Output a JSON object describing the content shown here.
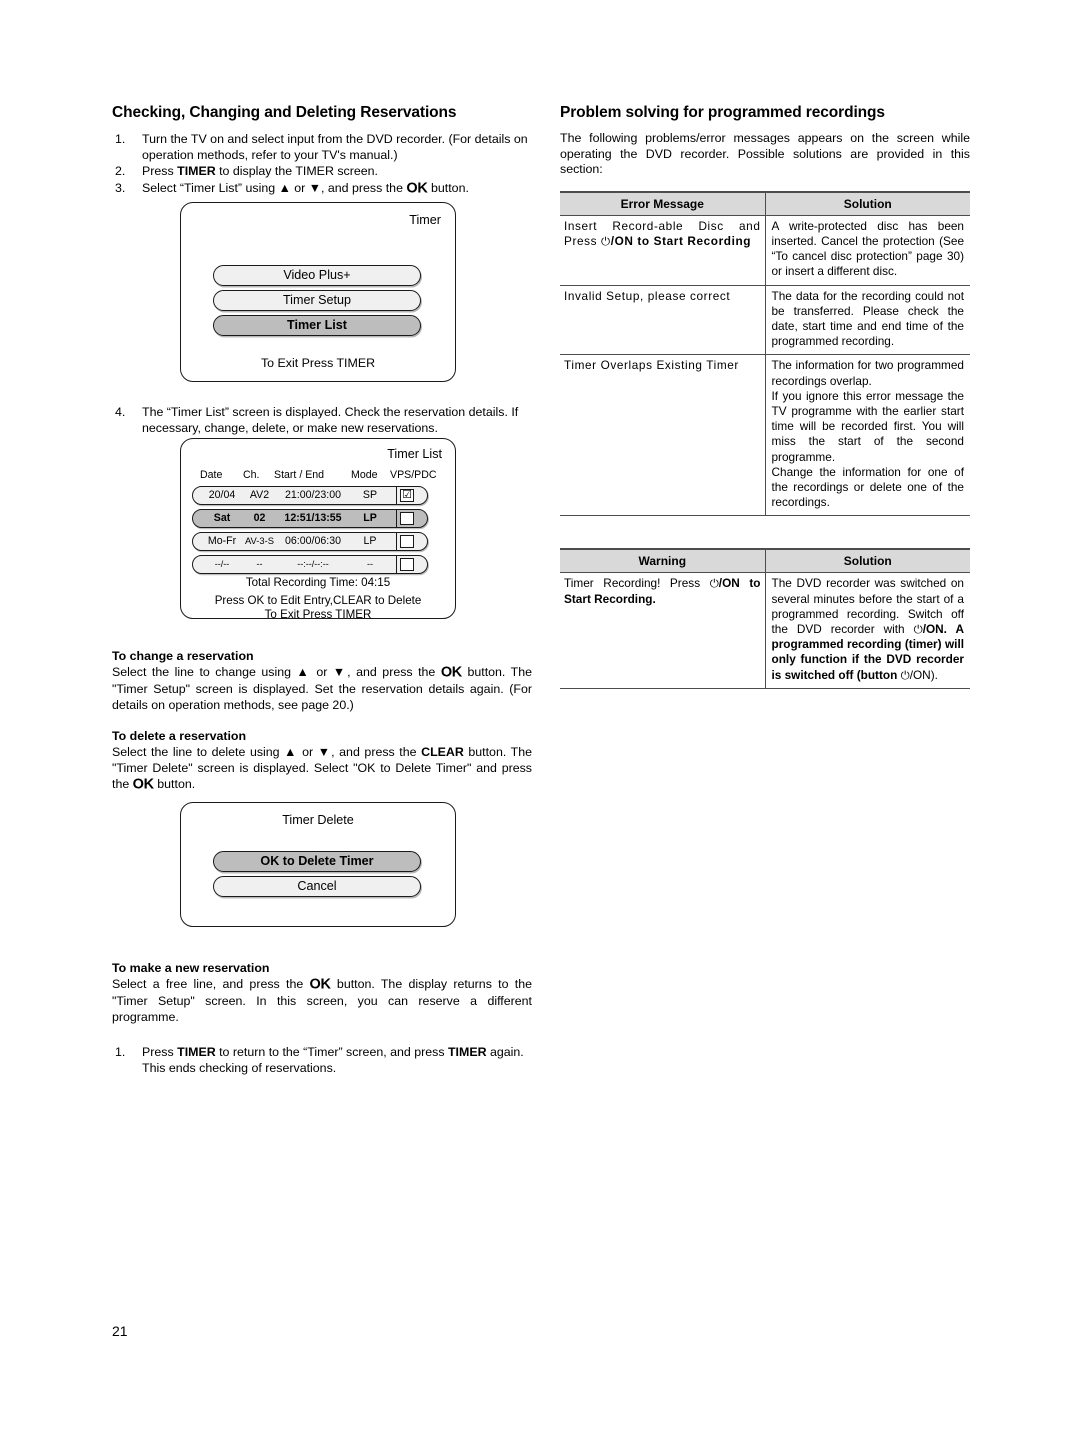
{
  "page": {
    "number": "21"
  },
  "left": {
    "heading": "Checking, Changing and Deleting Reservations",
    "steps": [
      {
        "num": "1.",
        "text_a": "Turn the TV on and select input from the DVD recorder. (For details on operation methods, refer to your TV's manual.)"
      },
      {
        "num": "2.",
        "pre": "Press ",
        "kw": "TIMER",
        "post": " to display the TIMER screen."
      },
      {
        "num": "3.",
        "pre": "Select “Timer List” using ▲ or ▼, and press the ",
        "kw": "OK",
        "post": " button."
      }
    ],
    "step4": {
      "num": "4.",
      "text": "The “Timer List” screen is displayed. Check the reservation details. If necessary, change, delete, or make new reservations."
    },
    "timer_screen": {
      "title": "Timer",
      "items": [
        {
          "label": "Video Plus+",
          "selected": false
        },
        {
          "label": "Timer Setup",
          "selected": false
        },
        {
          "label": "Timer List",
          "selected": true
        }
      ],
      "footer": "To Exit Press TIMER"
    },
    "timer_list_screen": {
      "title": "Timer List",
      "columns": [
        "Date",
        "Ch.",
        "Start / End",
        "Mode",
        "VPS/PDC"
      ],
      "rows": [
        {
          "date": "20/04",
          "ch": "AV2",
          "start_end": "21:00/23:00",
          "mode": "SP",
          "vps": "☑",
          "selected": false
        },
        {
          "date": "Sat",
          "ch": "02",
          "start_end": "12:51/13:55",
          "mode": "LP",
          "vps": "",
          "selected": true
        },
        {
          "date": "Mo-Fr",
          "ch": "AV-3-S",
          "start_end": "06:00/06:30",
          "mode": "LP",
          "vps": "",
          "selected": false
        },
        {
          "date": "--/--",
          "ch": "--",
          "start_end": "--:--/--:--",
          "mode": "--",
          "vps": "",
          "selected": false
        }
      ],
      "total": "Total Recording Time: 04:15",
      "footer1": "Press OK to Edit Entry,CLEAR to Delete",
      "footer2": "To Exit Press TIMER"
    },
    "change_section": {
      "heading": "To change a reservation",
      "p1": "Select the line to change using ▲ or ▼, and press the ",
      "ok": "OK",
      "p2": " button. The \"Timer Setup\" screen is displayed. Set the reservation details again. (For details on operation methods, see page 20.)"
    },
    "delete_section": {
      "heading": "To delete a reservation",
      "p1": "Select the line to delete using ▲ or ▼, and press the ",
      "kw": "CLEAR",
      "p2": " button. The \"Timer Delete\" screen is displayed. Select \"OK to Delete Timer\" and press the ",
      "ok": "OK",
      "p3": " button."
    },
    "timer_delete_screen": {
      "title": "Timer Delete",
      "items": [
        {
          "label": "OK to Delete Timer",
          "selected": true
        },
        {
          "label": "Cancel",
          "selected": false
        }
      ]
    },
    "new_section": {
      "heading": "To make a new reservation",
      "p1": "Select a free line, and press the ",
      "ok": "OK",
      "p2": " button. The display returns to the \"Timer Setup\" screen. In this screen, you can reserve a different programme."
    },
    "final_step": {
      "num": "1.",
      "p1": "Press ",
      "kw1": "TIMER",
      "p2": " to return to the “Timer” screen, and press ",
      "kw2": "TIMER",
      "p3": " again. This ends checking of reservations."
    }
  },
  "right": {
    "heading": "Problem solving for programmed recordings",
    "intro": "The following problems/error messages appears on the screen while operating the DVD recorder. Possible solutions are provided in this section:",
    "error_table": {
      "headers": [
        "Error Message",
        "Solution"
      ],
      "rows": [
        {
          "message_pre": "Insert Record-able Disc and Press ",
          "message_power": "⏻",
          "message_post": "/ON to Start Recording",
          "solution": "A write-protected disc has been inserted. Cancel the protection (See “To cancel disc protection” page 30) or insert a different disc."
        },
        {
          "message_pre": "Invalid Setup, please correct",
          "message_power": "",
          "message_post": "",
          "solution": "The data for the recording could not be transferred. Please check the date, start time and end time of the programmed recording."
        },
        {
          "message_pre": "Timer Overlaps Existing Timer",
          "message_power": "",
          "message_post": "",
          "solution_p1": "The information for two programmed recordings overlap.",
          "solution_p2": "If you ignore this error message the TV programme with the earlier start time will be recorded first. You will miss the start of the second programme.",
          "solution_p3": "Change the information for one of the recordings or delete one of the recordings."
        }
      ]
    },
    "warning_table": {
      "headers": [
        "Warning",
        "Solution"
      ],
      "row": {
        "message_pre": "Timer Recording! Press ",
        "message_power": "⏻",
        "message_post": "/ON to Start Recording.",
        "solution_a": "The DVD recorder was switched on several minutes before the start of a programmed recording. Switch off the DVD recorder with ",
        "solution_pwr1": "⏻",
        "solution_b": "/ON. A programmed recording (timer) will only function if the DVD recorder is switched off (button ",
        "solution_pwr2": "⏻",
        "solution_c": "/ON)."
      }
    }
  }
}
